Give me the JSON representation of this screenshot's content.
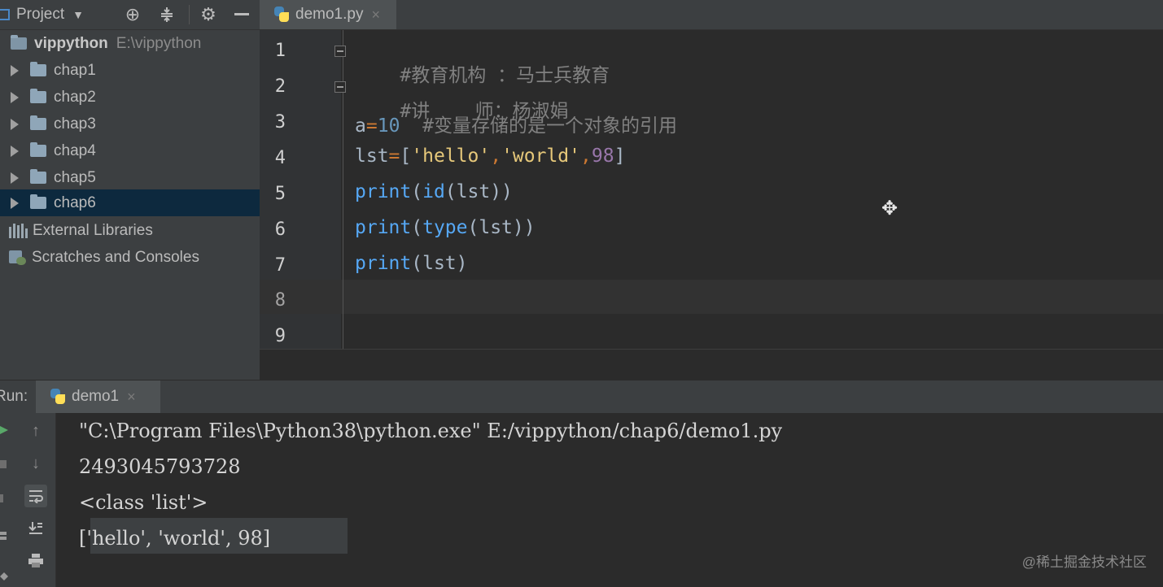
{
  "project_panel": {
    "title": "Project",
    "root": {
      "name": "vippython",
      "path": "E:\\vippython"
    },
    "folders": [
      {
        "label": "chap1"
      },
      {
        "label": "chap2"
      },
      {
        "label": "chap3"
      },
      {
        "label": "chap4"
      },
      {
        "label": "chap5"
      },
      {
        "label": "chap6"
      }
    ],
    "external_libraries": "External Libraries",
    "scratches": "Scratches and Consoles"
  },
  "editor": {
    "tab_label": "demo1.py",
    "close_glyph": "×",
    "line_numbers": [
      "1",
      "2",
      "3",
      "4",
      "5",
      "6",
      "7",
      "8",
      "9"
    ],
    "lines": {
      "l1": "#教育机构 ：马士兵教育",
      "l2": "#讲    师：杨淑娟",
      "l3": {
        "var": "a",
        "op": "=",
        "num": "10",
        "comment": "  #变量存储的是一个对象的引用"
      },
      "l4": {
        "var": "lst",
        "op": "=",
        "open": "[",
        "s1": "'hello'",
        "c1": ",",
        "s2": "'world'",
        "c2": ",",
        "num": "98",
        "close": "]"
      },
      "l5": {
        "fn": "print",
        "p1": "(",
        "b": "id",
        "p2": "(lst))"
      },
      "l6": {
        "fn": "print",
        "p1": "(",
        "b": "type",
        "p2": "(lst))"
      },
      "l7": {
        "fn": "print",
        "p1": "(lst)"
      }
    }
  },
  "run_panel": {
    "label": "Run:",
    "tab_label": "demo1",
    "close_glyph": "×",
    "output": [
      "\"C:\\Program Files\\Python38\\python.exe\" E:/vippython/chap6/demo1.py",
      "2493045793728",
      "<class 'list'>",
      "['hello', 'world', 98]"
    ]
  },
  "watermark": "@稀土掘金技术社区",
  "colors": {
    "background": "#2b2b2b",
    "panel": "#3c3f41",
    "selection": "#0d293e",
    "keyword": "#cc7832",
    "number": "#6897bb",
    "string": "#e6c87a",
    "comment": "#808080"
  }
}
